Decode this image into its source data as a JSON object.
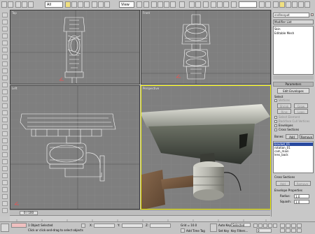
{
  "toolbar": {
    "selection_filter": "All",
    "coord_system": "View",
    "right_dropdown": "",
    "accent_color": "#f0e080"
  },
  "viewports": [
    {
      "name": "top",
      "label": "Top"
    },
    {
      "name": "front",
      "label": "Front"
    },
    {
      "name": "left",
      "label": "Left"
    },
    {
      "name": "perspective",
      "label": "Perspective",
      "active": true
    }
  ],
  "command_panel": {
    "object_name": "endlesspot",
    "modifier_list_label": "Modifier List",
    "stack_items": [
      "Skin",
      "Editable Mesh"
    ],
    "parameters_title": "Parameters",
    "edit_envelopes_label": "Edit Envelopes",
    "select_label": "Select",
    "vertices_label": "Vertices",
    "shrink_label": "Shrink",
    "grow_label": "Grow",
    "ring_label": "Ring",
    "loop_label": "Loop",
    "select_element_label": "Select Element",
    "backface_label": "Backface Cull Vertices",
    "envelopes_label": "Envelopes",
    "cross_sections_label": "Cross Sections",
    "bones_label": "Bones:",
    "add_label": "Add",
    "remove_label": "Remove",
    "bones": [
      "bracket_01",
      "rotation_01",
      "cam_main",
      "lens_back"
    ],
    "cross_sections_title": "Cross Sections",
    "add_cs_label": "Add",
    "remove_cs_label": "Remove",
    "envelope_props_title": "Envelope Properties",
    "radius_label": "Radius:",
    "radius_value": "1.0",
    "squash_label": "Squash:",
    "squash_value": "1.0"
  },
  "timeline": {
    "frame_readout": "0 / 100"
  },
  "status": {
    "objects_selected": "1 Object Selected",
    "prompt": "Click or click-and-drag to select objects",
    "lock_label": "",
    "x_label": "X:",
    "y_label": "Y:",
    "z_label": "Z:",
    "grid_label": "Grid = 10.0",
    "add_time_tag": "Add Time Tag",
    "auto_key": "Auto Key",
    "selected_label": "Selected",
    "set_key": "Set Key",
    "key_filters": "Key Filters...",
    "frame_value": "0"
  }
}
